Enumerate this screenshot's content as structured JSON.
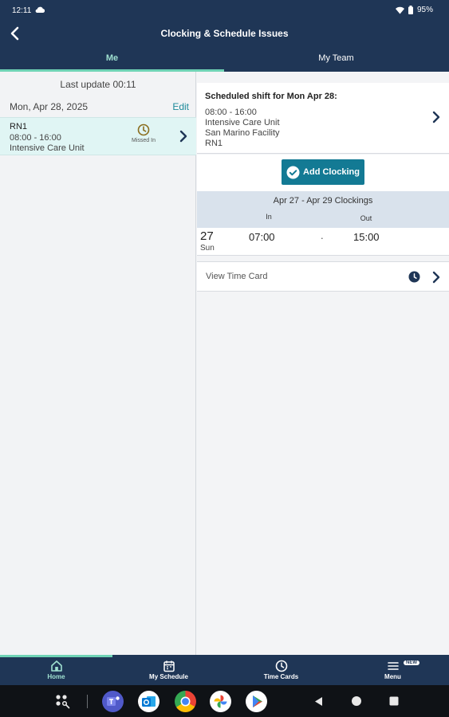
{
  "status_bar": {
    "time": "12:11",
    "battery": "95%"
  },
  "header": {
    "title": "Clocking & Schedule Issues"
  },
  "tabs": [
    {
      "label": "Me"
    },
    {
      "label": "My Team"
    }
  ],
  "left": {
    "last_update": "Last update 00:11",
    "date": "Mon, Apr 28, 2025",
    "edit_label": "Edit",
    "shift": {
      "role": "RN1",
      "hours": "08:00 - 16:00",
      "unit": "Intensive Care Unit",
      "status": "Missed In"
    }
  },
  "right": {
    "scheduled": {
      "title": "Scheduled shift for Mon Apr 28:",
      "hours": "08:00 - 16:00",
      "unit": "Intensive Care Unit",
      "facility": "San Marino Facility",
      "role": "RN1"
    },
    "add_clocking_label": "Add Clocking",
    "clockings": {
      "range": "Apr 27 - Apr 29 Clockings",
      "in_header": "In",
      "out_header": "Out",
      "rows": [
        {
          "day": "27",
          "dow": "Sun",
          "in": "07:00",
          "mid": ".",
          "out": "15:00"
        }
      ]
    },
    "view_time_card_label": "View Time Card"
  },
  "bottom_nav": [
    {
      "label": "Home",
      "icon": "home-icon"
    },
    {
      "label": "My Schedule",
      "icon": "calendar-icon"
    },
    {
      "label": "Time Cards",
      "icon": "clock-icon"
    },
    {
      "label": "Menu",
      "icon": "menu-icon",
      "badge": "NEW"
    }
  ],
  "colors": {
    "header_bg": "#1f3656",
    "accent": "#6fd3b5",
    "button": "#137a94",
    "selected_row": "#e0f5f4"
  }
}
